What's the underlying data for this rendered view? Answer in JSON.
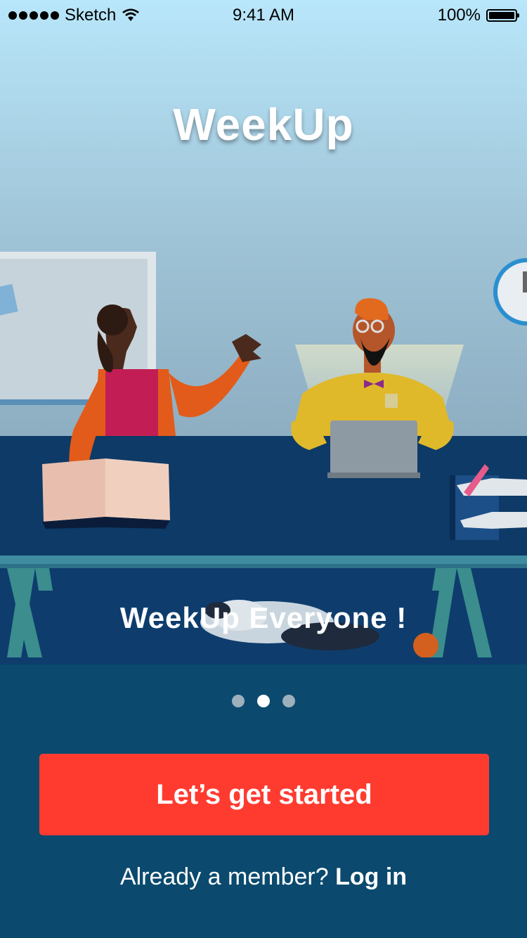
{
  "status_bar": {
    "carrier": "Sketch",
    "time": "9:41 AM",
    "battery": "100%"
  },
  "hero": {
    "app_title": "WeekUp",
    "caption": "WeekUp Everyone !"
  },
  "pager": {
    "count": 3,
    "active_index": 1
  },
  "cta": {
    "label": "Let’s get started"
  },
  "login": {
    "prompt": "Already a member? ",
    "link_label": "Log in"
  },
  "colors": {
    "accent": "#ff3b30",
    "background": "#0b4a6e",
    "sky_top": "#b6e3f6",
    "desk": "#0d3a66"
  }
}
